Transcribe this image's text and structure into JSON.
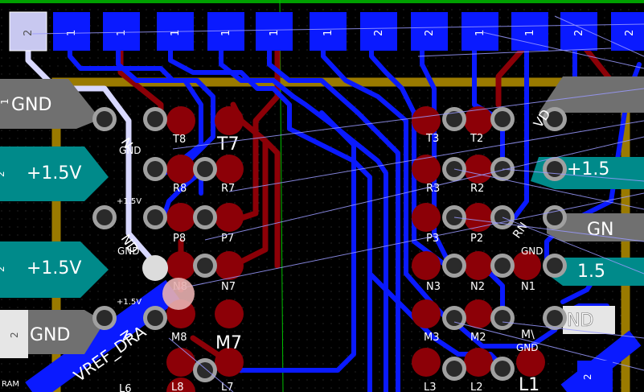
{
  "board": {
    "background": "#000000",
    "colors": {
      "front_copper": "#0a1aff",
      "back_copper": "#8c0007",
      "silk": "#9a7a00",
      "ratsnest": "#b0b0ff",
      "edge": "#00a000",
      "via_ring": "#a0a0a0",
      "pad_teal": "#008a8a",
      "pad_gray": "#707070",
      "highlight": "#e0e0ff"
    }
  },
  "top_pads": [
    {
      "num": "2",
      "selected": true
    },
    {
      "num": "1"
    },
    {
      "num": "1"
    },
    {
      "num": "1"
    },
    {
      "num": "1"
    },
    {
      "num": "1"
    },
    {
      "num": "1"
    },
    {
      "num": "2"
    },
    {
      "num": "2"
    },
    {
      "num": "1"
    },
    {
      "num": "1"
    },
    {
      "num": "2"
    },
    {
      "num": "2"
    }
  ],
  "side_pads_left": [
    {
      "num": "1",
      "net": "GND"
    },
    {
      "num": "2",
      "net": "+1.5V"
    },
    {
      "num": "2",
      "net": "+1.5V"
    },
    {
      "num": "2",
      "net": "GND"
    }
  ],
  "side_pads_left_net_text": {
    "gnd": "GND",
    "v15": "+1.5V"
  },
  "right_side_pad_text": {
    "gnd": "GND",
    "v15": "+1.5",
    "gnd2": "GN",
    "v15b": "1.5",
    "nd": "ND"
  },
  "bga_labels": [
    "T8",
    "T7",
    "R8",
    "R7",
    "P8",
    "P7",
    "N8",
    "N7",
    "M8",
    "M7",
    "L8",
    "L7",
    "L6",
    "T3",
    "T2",
    "R3",
    "R2",
    "P3",
    "P2",
    "N3",
    "N2",
    "N1",
    "M3",
    "M2",
    "L3",
    "L2",
    "L1"
  ],
  "small_labels": {
    "gnd": "GND",
    "v15": "+1.5V",
    "vref": "VREF_DRA",
    "ram": "RAM",
    "vd": "VD",
    "g": "G",
    "n": "N",
    "nd": "ND",
    "rn": "RN",
    "mv": "M\\"
  },
  "bottom_right_pad": {
    "num": "2"
  }
}
